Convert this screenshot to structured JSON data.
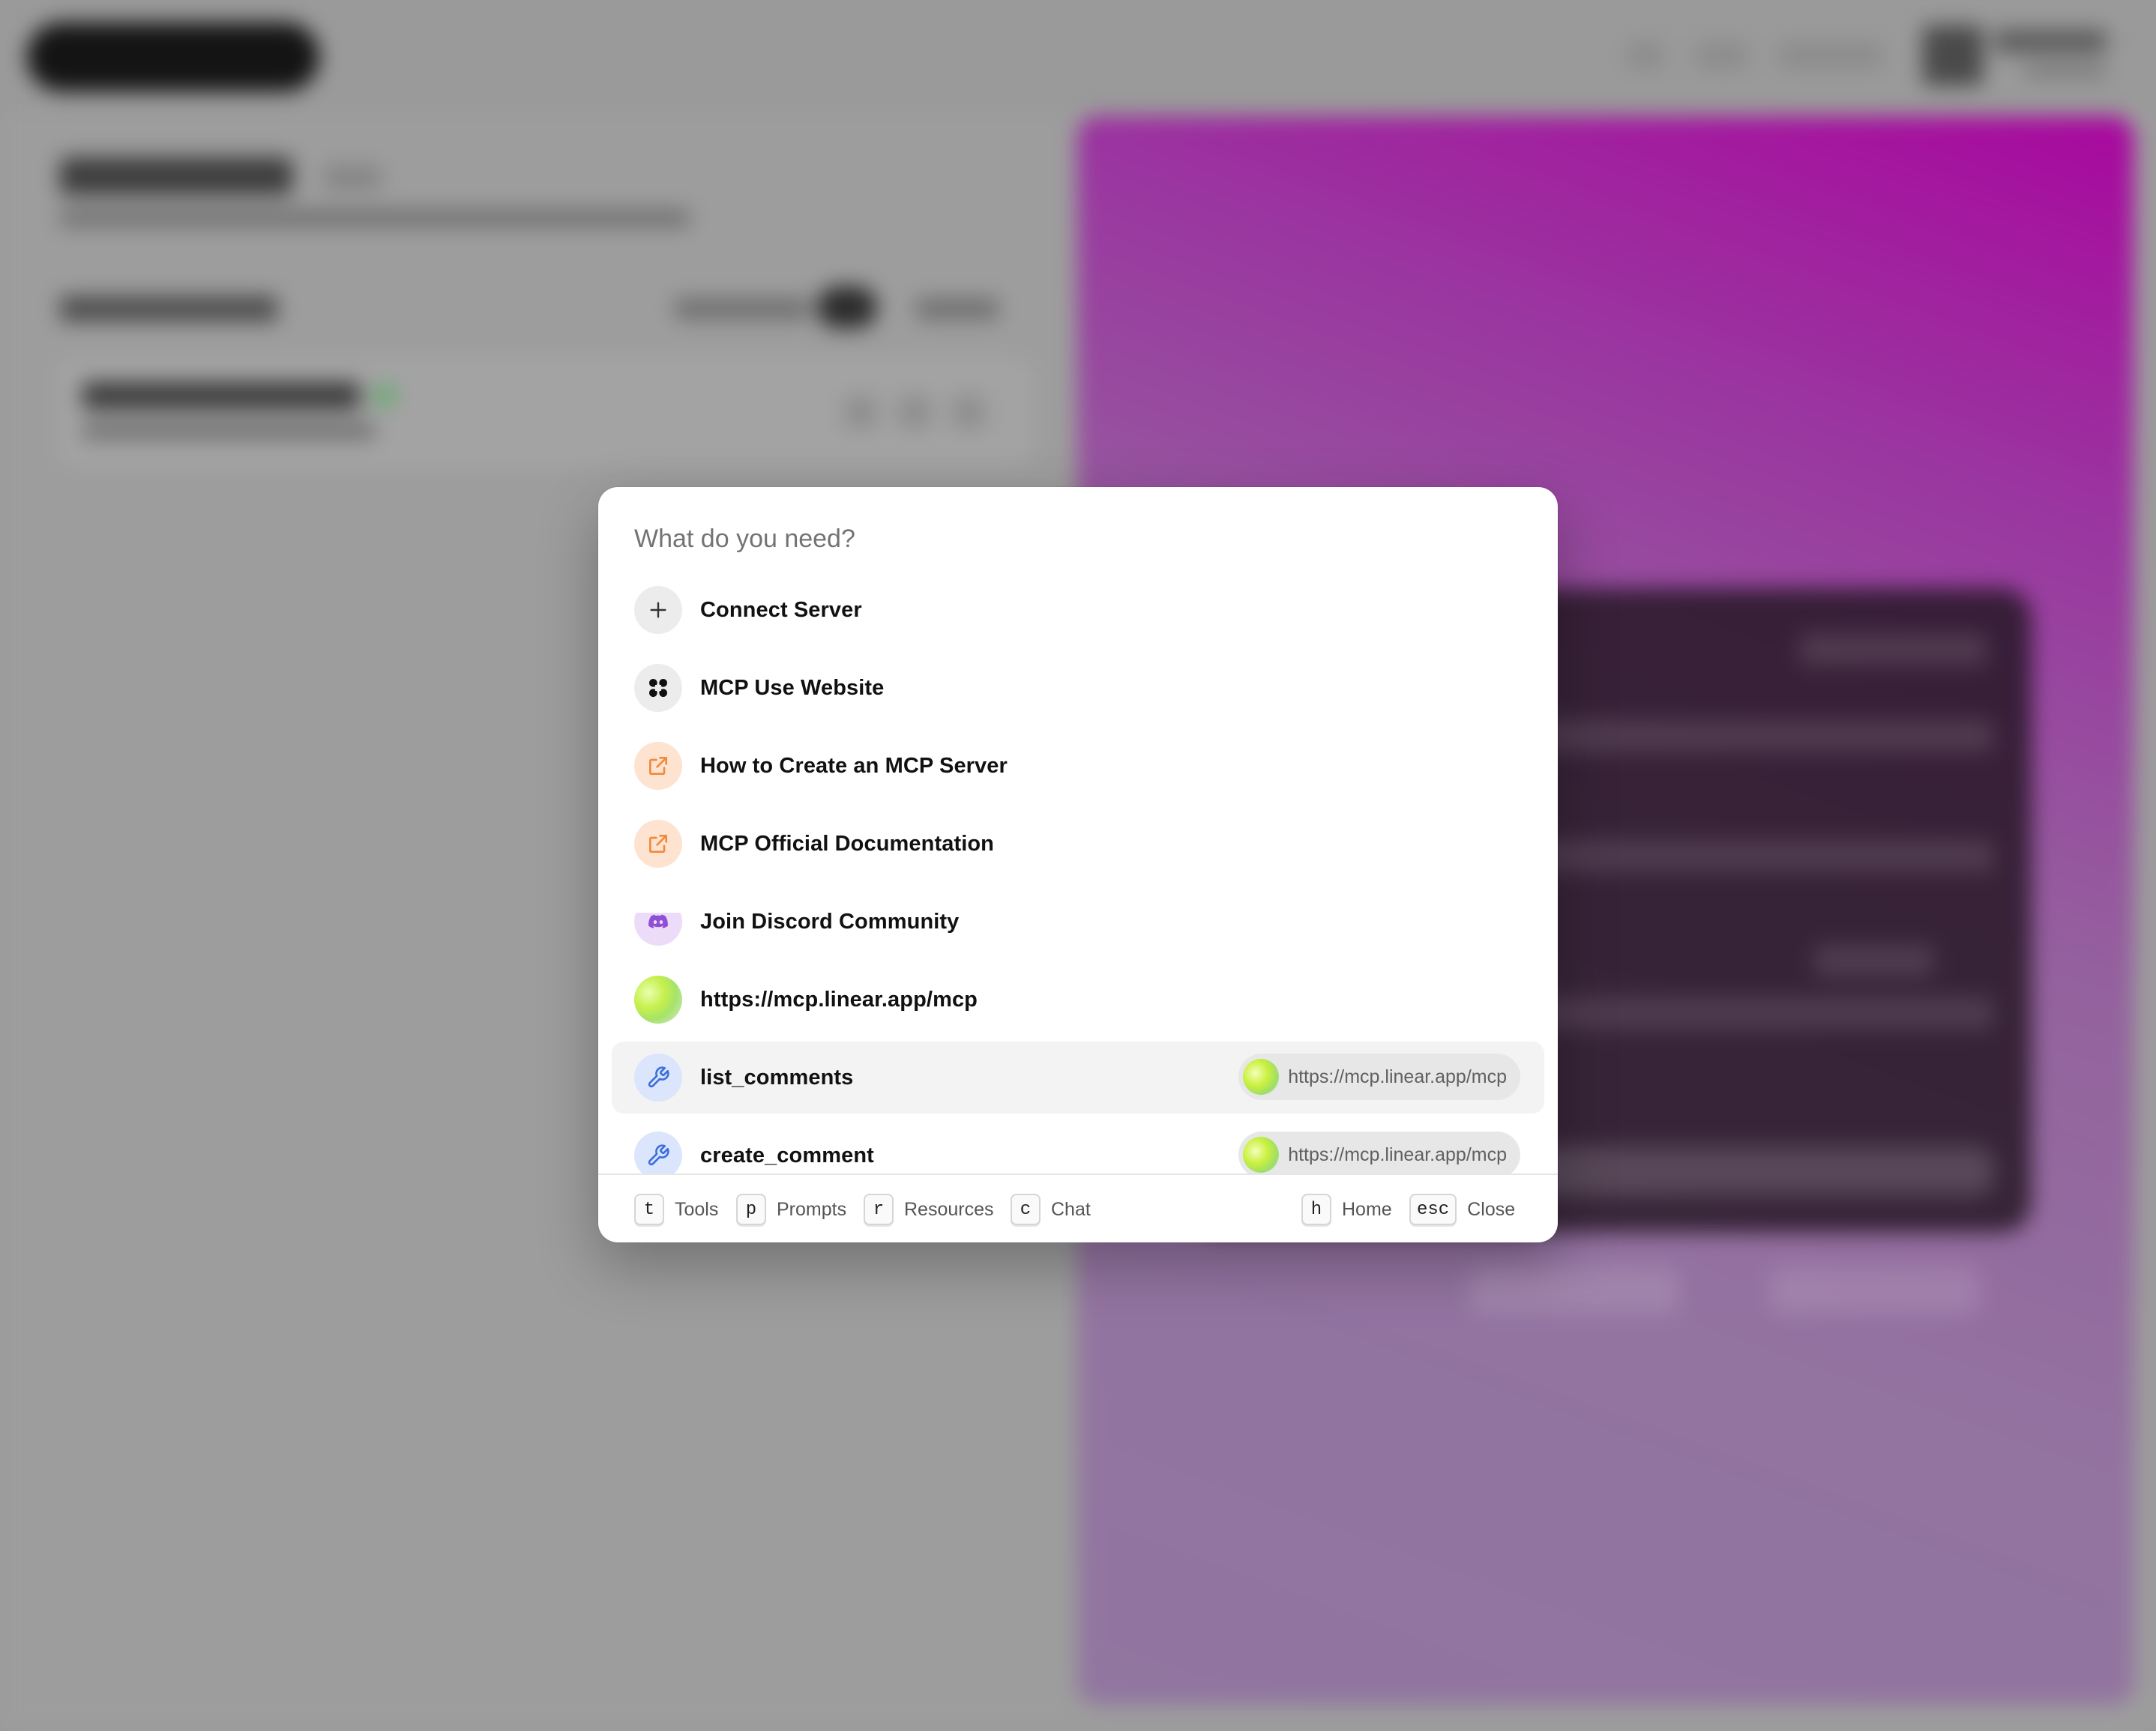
{
  "palette": {
    "search_placeholder": "What do you need?",
    "items": [
      {
        "label": "Connect Server",
        "icon": "plus-icon"
      },
      {
        "label": "MCP Use Website",
        "icon": "mcp-use-logo-icon"
      },
      {
        "label": "How to Create an MCP Server",
        "icon": "external-link-icon"
      },
      {
        "label": "MCP Official Documentation",
        "icon": "external-link-icon"
      },
      {
        "label": "Join Discord Community",
        "icon": "discord-icon"
      },
      {
        "label": "https://mcp.linear.app/mcp",
        "icon": "linear-server-icon"
      },
      {
        "label": "list_comments",
        "icon": "wrench-icon",
        "server": "https://mcp.linear.app/mcp",
        "selected": true
      },
      {
        "label": "create_comment",
        "icon": "wrench-icon",
        "server": "https://mcp.linear.app/mcp"
      }
    ],
    "footer": {
      "left": [
        {
          "key": "t",
          "label": "Tools"
        },
        {
          "key": "p",
          "label": "Prompts"
        },
        {
          "key": "r",
          "label": "Resources"
        },
        {
          "key": "c",
          "label": "Chat"
        }
      ],
      "right": [
        {
          "key": "h",
          "label": "Home"
        },
        {
          "key": "esc",
          "label": "Close"
        }
      ]
    }
  },
  "colors": {
    "overlay": "#9a9a9a",
    "selected_row": "#f3f3f3",
    "external_link_accent": "#f08a3c",
    "discord_accent": "#8f4fd6",
    "wrench_accent": "#3b6fdf"
  }
}
